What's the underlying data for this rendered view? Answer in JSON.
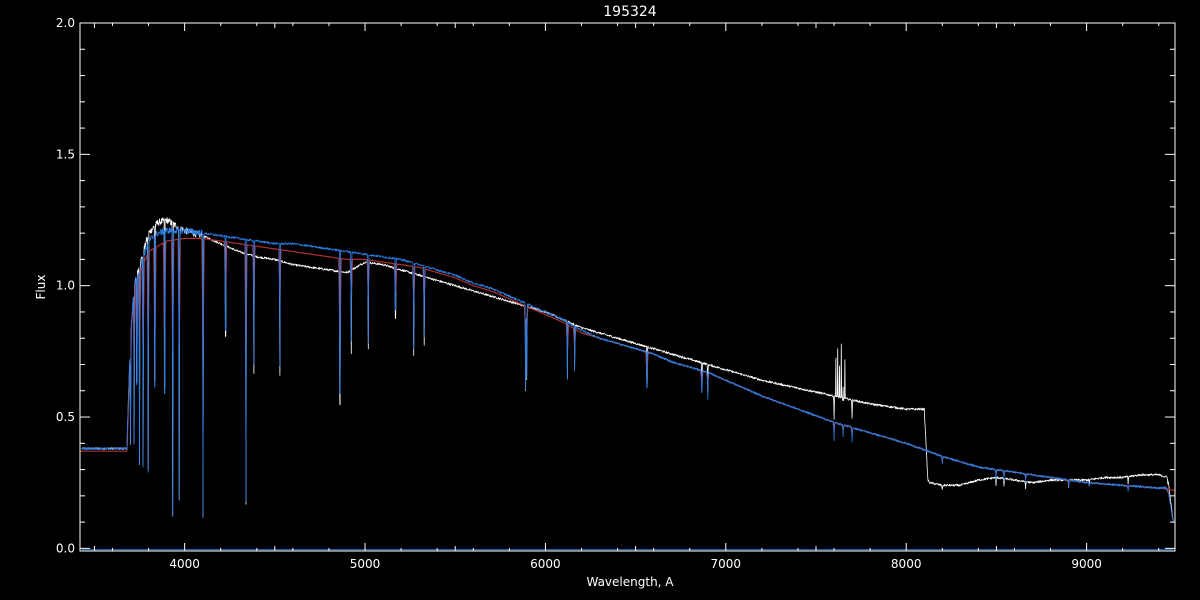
{
  "chart_data": {
    "type": "line",
    "title": "195324",
    "xlabel": "Wavelength, A",
    "ylabel": "Flux",
    "xlim": [
      3420,
      9490
    ],
    "ylim": [
      -0.01,
      2.0
    ],
    "x_ticks": [
      4000,
      5000,
      6000,
      7000,
      8000,
      9000
    ],
    "x_tick_labels": [
      "4000",
      "5000",
      "6000",
      "7000",
      "8000",
      "9000"
    ],
    "y_ticks": [
      0.0,
      0.5,
      1.0,
      1.5,
      2.0
    ],
    "y_tick_labels": [
      "0.0",
      "0.5",
      "1.0",
      "1.5",
      "2.0"
    ],
    "grid": false,
    "background": "#000000",
    "axis_color": "#ffffff",
    "series": [
      {
        "color": "#ffffff",
        "x": [
          3430,
          3600,
          3680,
          3700,
          3720,
          3800,
          3850,
          3900,
          3950,
          4000,
          4100,
          4200,
          4300,
          4400,
          4500,
          4600,
          4700,
          4800,
          4900,
          5000,
          5100,
          5200,
          5300,
          5400,
          5500,
          5600,
          5700,
          5800,
          5900,
          6000,
          6100,
          6200,
          6300,
          6400,
          6500,
          6600,
          6700,
          6800,
          6900,
          7000,
          7200,
          7400,
          7600,
          7800,
          8000,
          8100,
          8120,
          8130,
          8200,
          8300,
          8400,
          8500,
          8600,
          8700,
          8800,
          8900,
          9000,
          9100,
          9200,
          9300,
          9400,
          9450,
          9480
        ],
        "y": [
          0.38,
          0.38,
          0.38,
          0.8,
          1.0,
          1.2,
          1.24,
          1.25,
          1.23,
          1.21,
          1.19,
          1.16,
          1.13,
          1.11,
          1.1,
          1.08,
          1.07,
          1.06,
          1.05,
          1.09,
          1.08,
          1.06,
          1.04,
          1.02,
          1.0,
          0.98,
          0.96,
          0.94,
          0.92,
          0.9,
          0.87,
          0.84,
          0.82,
          0.8,
          0.78,
          0.76,
          0.74,
          0.72,
          0.7,
          0.68,
          0.64,
          0.61,
          0.58,
          0.55,
          0.53,
          0.53,
          0.26,
          0.25,
          0.24,
          0.24,
          0.26,
          0.27,
          0.26,
          0.25,
          0.26,
          0.26,
          0.26,
          0.27,
          0.27,
          0.28,
          0.28,
          0.27,
          0.1
        ]
      },
      {
        "color": "#b03030",
        "x": [
          3420,
          3600,
          3680,
          3700,
          3720,
          3800,
          3900,
          4000,
          4100,
          4200,
          4300,
          4400,
          4500,
          4600,
          4700,
          4800,
          4900,
          5000,
          5100,
          5200,
          5300,
          5400,
          5500,
          5600,
          5700,
          5800,
          5900,
          6000,
          6100,
          6200,
          6300,
          6400,
          6500,
          6600,
          6700,
          6800,
          6900,
          7000,
          7200,
          7400,
          7600,
          7800,
          8000,
          8200,
          8400,
          8600,
          8800,
          9000,
          9200,
          9400,
          9490
        ],
        "y": [
          0.37,
          0.37,
          0.37,
          0.8,
          1.0,
          1.13,
          1.17,
          1.18,
          1.18,
          1.17,
          1.16,
          1.15,
          1.14,
          1.13,
          1.12,
          1.11,
          1.1,
          1.1,
          1.09,
          1.08,
          1.07,
          1.05,
          1.03,
          1.0,
          0.98,
          0.95,
          0.92,
          0.89,
          0.86,
          0.82,
          0.8,
          0.78,
          0.76,
          0.74,
          0.71,
          0.69,
          0.67,
          0.64,
          0.58,
          0.53,
          0.48,
          0.44,
          0.4,
          0.35,
          0.31,
          0.29,
          0.27,
          0.25,
          0.24,
          0.23,
          0.22
        ]
      },
      {
        "color": "#2b7fe6",
        "x": [
          3430,
          3600,
          3680,
          3700,
          3720,
          3800,
          3850,
          3900,
          4000,
          4100,
          4200,
          4300,
          4400,
          4500,
          4600,
          4700,
          4800,
          4900,
          5000,
          5100,
          5200,
          5300,
          5400,
          5500,
          5600,
          5700,
          5800,
          5900,
          6000,
          6100,
          6200,
          6300,
          6400,
          6500,
          6600,
          6700,
          6800,
          6900,
          7000,
          7200,
          7400,
          7600,
          7800,
          8000,
          8200,
          8400,
          8600,
          8800,
          9000,
          9200,
          9400,
          9450,
          9480
        ],
        "y": [
          0.38,
          0.38,
          0.38,
          0.8,
          1.0,
          1.17,
          1.2,
          1.21,
          1.21,
          1.2,
          1.19,
          1.18,
          1.17,
          1.16,
          1.16,
          1.15,
          1.14,
          1.13,
          1.12,
          1.11,
          1.1,
          1.08,
          1.06,
          1.04,
          1.01,
          0.99,
          0.96,
          0.93,
          0.9,
          0.87,
          0.83,
          0.8,
          0.78,
          0.76,
          0.74,
          0.71,
          0.69,
          0.67,
          0.64,
          0.58,
          0.53,
          0.48,
          0.44,
          0.4,
          0.35,
          0.31,
          0.29,
          0.27,
          0.25,
          0.24,
          0.23,
          0.23,
          0.1
        ]
      },
      {
        "color": "#2b7fe6",
        "x": [
          3430,
          9480
        ],
        "y": [
          -0.005,
          -0.005
        ]
      }
    ],
    "absorption_lines": {
      "x": [
        3700,
        3720,
        3735,
        3750,
        3770,
        3798,
        3835,
        3889,
        3934,
        3970,
        4102,
        4227,
        4340,
        4384,
        4528,
        4861,
        4924,
        5018,
        5169,
        5270,
        5328,
        5890,
        5896,
        6122,
        6162,
        6563,
        6867,
        6900,
        7600,
        7650,
        7700,
        8200,
        8498,
        8542,
        8662,
        8900,
        9015,
        9230,
        9450
      ],
      "depth": [
        0.5,
        0.6,
        0.65,
        0.7,
        0.72,
        0.75,
        0.8,
        0.85,
        0.9,
        0.85,
        0.9,
        0.5,
        0.85,
        0.4,
        0.4,
        0.8,
        0.3,
        0.3,
        0.3,
        0.3,
        0.25,
        0.35,
        0.3,
        0.25,
        0.2,
        0.3,
        0.2,
        0.15,
        0.15,
        0.1,
        0.12,
        0.08,
        0.12,
        0.12,
        0.12,
        0.1,
        0.08,
        0.1,
        0.08
      ]
    },
    "emission_spikes": {
      "x": [
        7610,
        7620,
        7630,
        7640,
        7650,
        7660
      ],
      "height": [
        0.15,
        0.18,
        0.12,
        0.2,
        0.1,
        0.15
      ]
    }
  }
}
